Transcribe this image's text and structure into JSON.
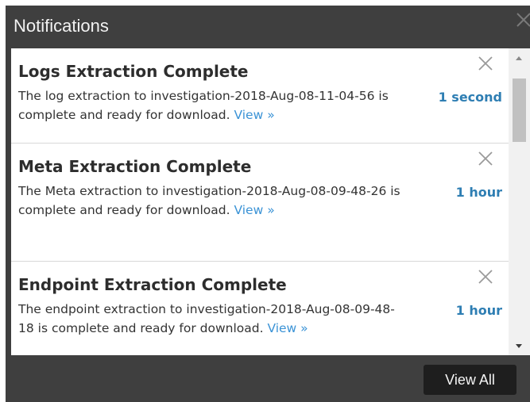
{
  "header": {
    "title": "Notifications",
    "close_icon": "close-icon"
  },
  "notifications": [
    {
      "title": "Logs Extraction Complete",
      "body": "The log extraction to investigation-2018-Aug-08-11-04-56 is complete and ready for download.",
      "link": "View »",
      "time": "1 second",
      "close_icon": "close-icon"
    },
    {
      "title": "Meta Extraction Complete",
      "body": "The Meta extraction to investigation-2018-Aug-08-09-48-26 is complete and ready for download.",
      "link": "View »",
      "time": "1 hour",
      "close_icon": "close-icon"
    },
    {
      "title": "Endpoint Extraction Complete",
      "body": "The endpoint extraction to investigation-2018-Aug-08-09-48-18 is complete and ready for download.",
      "link": "View »",
      "time": "1 hour",
      "close_icon": "close-icon"
    }
  ],
  "scrollbar": {
    "up_icon": "scroll-up-arrow-icon",
    "down_icon": "scroll-down-arrow-icon"
  },
  "footer": {
    "view_all_label": "View All"
  },
  "colors": {
    "panel_background": "#3f3f3f",
    "time_accent": "#2e7eb3",
    "link": "#3b93d6",
    "button_background": "#1e1e1e"
  }
}
